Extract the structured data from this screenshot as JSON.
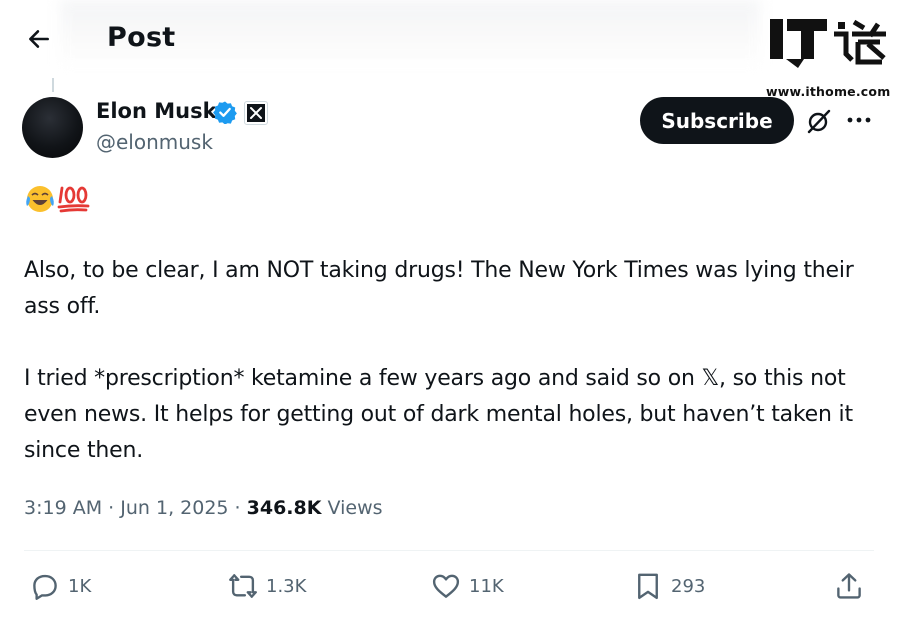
{
  "header": {
    "title": "Post"
  },
  "watermark": {
    "logo_text": "IT之家",
    "url": "www.ithome.com"
  },
  "author": {
    "name": "Elon Musk",
    "handle": "@elonmusk"
  },
  "subscribe_label": "Subscribe",
  "tweet": {
    "emoji": [
      "😂",
      "💯"
    ],
    "paragraphs": [
      "Also, to be clear, I am NOT taking drugs! The New York Times was lying their ass off.",
      "I tried *prescription* ketamine a few years ago and said so on 𝕏, so this not even news. It helps for getting out of dark mental holes, but haven’t taken it since then."
    ]
  },
  "meta": {
    "time": "3:19 AM",
    "separator": "·",
    "date": "Jun 1, 2025",
    "views_count": "346.8K",
    "views_label": "Views"
  },
  "actions": {
    "replies": "1K",
    "reposts": "1.3K",
    "likes": "11K",
    "bookmarks": "293"
  },
  "icons": {
    "back": "arrow-left-icon",
    "verified": "verified-badge-icon",
    "affiliate": "x-logo-icon",
    "grok": "grok-icon",
    "more": "more-horizontal-icon",
    "reply": "reply-icon",
    "repost": "repost-icon",
    "like": "heart-icon",
    "bookmark": "bookmark-icon",
    "share": "share-icon"
  },
  "colors": {
    "text": "#0f1419",
    "secondary": "#536471",
    "verified": "#1d9bf0",
    "button": "#0f1419",
    "divider": "#eff3f4"
  }
}
